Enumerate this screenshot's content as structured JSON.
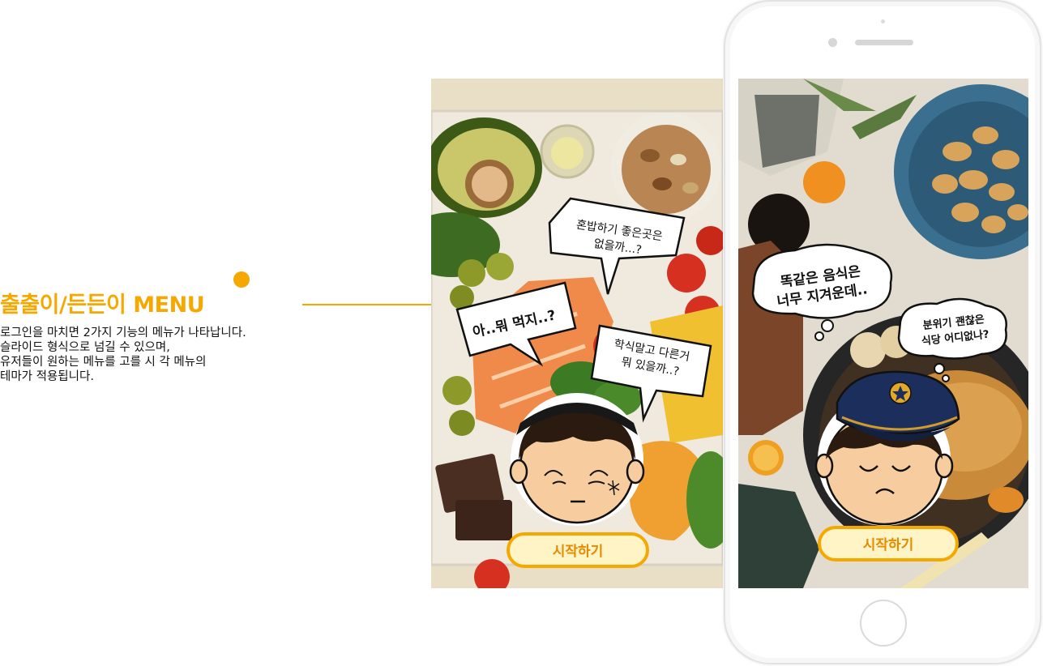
{
  "section": {
    "title": "출출이/든든이 MENU",
    "description_lines": [
      "로그인을 마치면 2가지 기능의 메뉴가 나타납니다.",
      "슬라이드 형식으로  넘길 수 있으며,",
      "유저들이 원하는 메뉴를 고를 시 각 메뉴의",
      "테마가 적용됩니다."
    ]
  },
  "screen_left": {
    "bubble_1": [
      "혼밥하기 좋은곳은",
      "없을까...?"
    ],
    "bubble_2": "아..뭐 먹지..?",
    "bubble_3": [
      "학식말고 다른거",
      "뭐 있을까..?"
    ],
    "start_button": "시작하기"
  },
  "screen_right": {
    "bubble_1": [
      "똑같은 음식은",
      "너무 지겨운데.."
    ],
    "bubble_2": [
      "분위기 괜찮은",
      "식당 어디없나?"
    ],
    "start_button": "시작하기"
  },
  "colors": {
    "accent": "#f5a800",
    "button_fill": "#fff4c6",
    "cap_navy": "#1c2f5c",
    "skin": "#f7cda0",
    "hair": "#2a1a10"
  },
  "icons": {
    "badge": "star-badge-icon",
    "home": "home-button-icon"
  }
}
